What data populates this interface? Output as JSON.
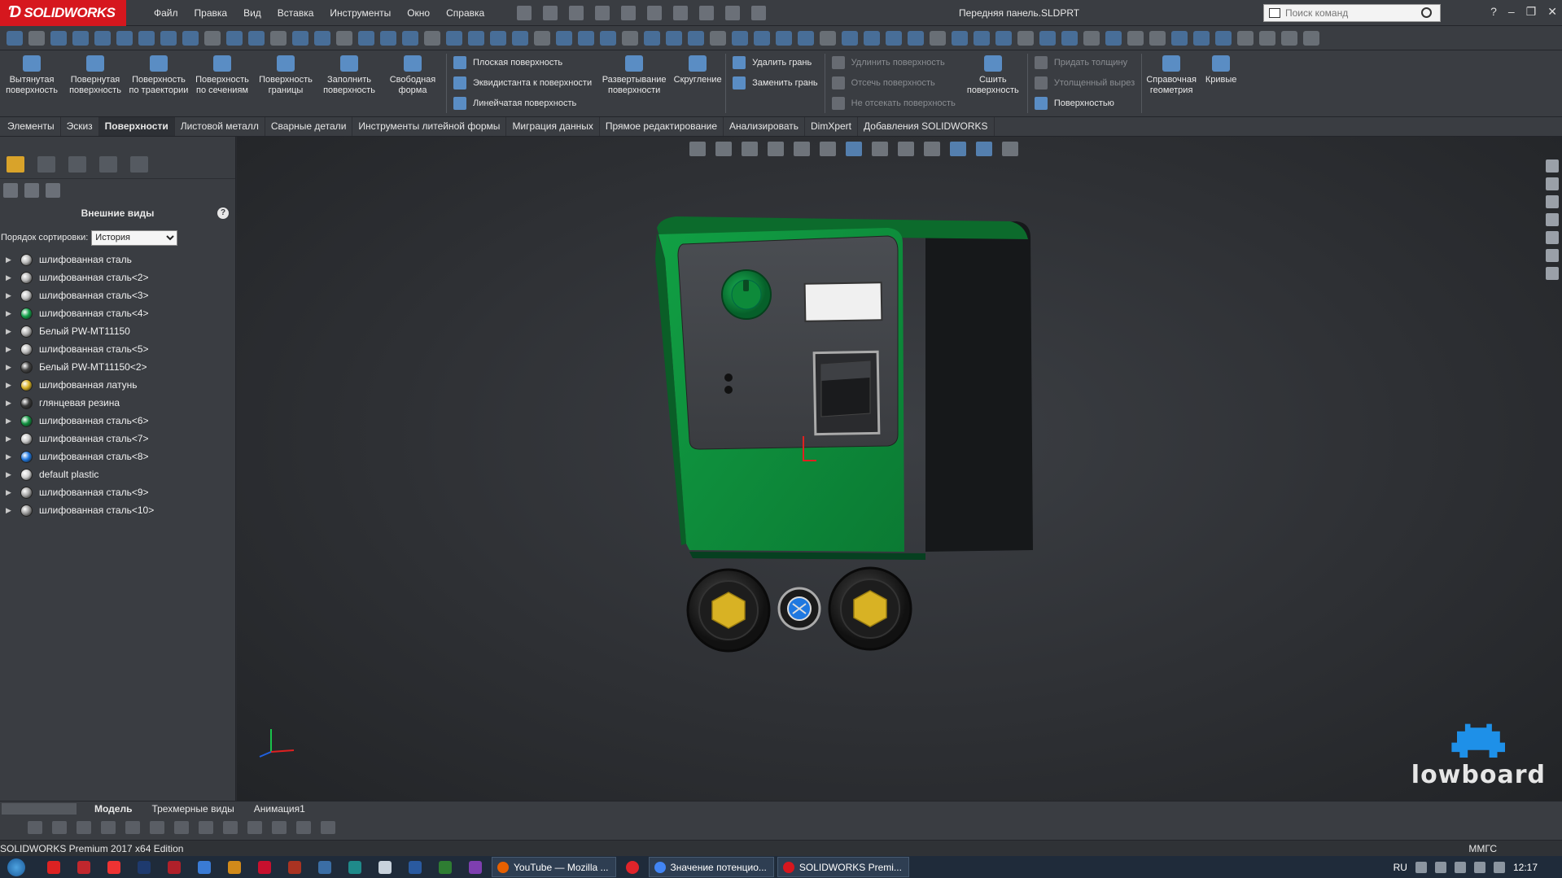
{
  "app": {
    "logo": "SOLIDWORKS",
    "document_title": "Передняя панель.SLDPRT"
  },
  "menu": [
    "Файл",
    "Правка",
    "Вид",
    "Вставка",
    "Инструменты",
    "Окно",
    "Справка"
  ],
  "search": {
    "placeholder": "Поиск команд"
  },
  "ribbon": {
    "big_buttons": [
      "Вытянутая поверхность",
      "Повернутая поверхность",
      "Поверхность по траектории",
      "Поверхность по сечениям",
      "Поверхность границы",
      "Заполнить поверхность",
      "Свободная форма"
    ],
    "col1": [
      "Плоская поверхность",
      "Эквидистанта к поверхности",
      "Линейчатая поверхность"
    ],
    "mid_buttons": [
      "Развертывание поверхности",
      "Скругление"
    ],
    "col2": [
      "Удалить грань",
      "Заменить грань"
    ],
    "col3": [
      "Удлинить поверхность",
      "Отсечь поверхность",
      "Не отсекать поверхность"
    ],
    "knit": "Сшить поверхность",
    "col4": [
      "Придать толщину",
      "Утолщенный вырез",
      "Поверхностью"
    ],
    "end_buttons": [
      "Справочная геометрия",
      "Кривые"
    ]
  },
  "tabs": [
    "Элементы",
    "Эскиз",
    "Поверхности",
    "Листовой металл",
    "Сварные детали",
    "Инструменты литейной формы",
    "Миграция данных",
    "Прямое редактирование",
    "Анализировать",
    "DimXpert",
    "Добавления SOLIDWORKS"
  ],
  "active_tab": "Поверхности",
  "panel": {
    "title": "Внешние виды",
    "help": "?",
    "sort_label": "Порядок сортировки:",
    "sort_value": "История",
    "items": [
      {
        "label": "шлифованная сталь",
        "color": "#b9b9b9"
      },
      {
        "label": "шлифованная сталь<2>",
        "color": "#b5b5b5"
      },
      {
        "label": "шлифованная сталь<3>",
        "color": "#c2c2c2"
      },
      {
        "label": "шлифованная сталь<4>",
        "color": "#12a24a"
      },
      {
        "label": "Белый PW-MT11150",
        "color": "#b0b0b0"
      },
      {
        "label": "шлифованная сталь<5>",
        "color": "#bdbdbd"
      },
      {
        "label": "Белый PW-MT11150<2>",
        "color": "#444444"
      },
      {
        "label": "шлифованная латунь",
        "color": "#d8b224"
      },
      {
        "label": "глянцевая резина",
        "color": "#3a3a3a"
      },
      {
        "label": "шлифованная сталь<6>",
        "color": "#109140"
      },
      {
        "label": "шлифованная сталь<7>",
        "color": "#c8c8c8"
      },
      {
        "label": "шлифованная сталь<8>",
        "color": "#1f78e0"
      },
      {
        "label": "default plastic",
        "color": "#d0d0d0"
      },
      {
        "label": "шлифованная сталь<9>",
        "color": "#a8a8a8"
      },
      {
        "label": "шлифованная сталь<10>",
        "color": "#9c9c9c"
      }
    ]
  },
  "watermark": "lowboard",
  "bottom_tabs": [
    "Модель",
    "Трехмерные виды",
    "Анимация1"
  ],
  "status": {
    "text": "SOLIDWORKS Premium 2017 x64 Edition",
    "units": "ММГС"
  },
  "taskbar": {
    "tasks": [
      {
        "label": "YouTube — Mozilla ...",
        "color": "#e66000"
      },
      {
        "label": "Значение потенцио...",
        "color": "#4285f4"
      },
      {
        "label": "SOLIDWORKS Premi...",
        "color": "#d6171e"
      }
    ],
    "lang": "RU",
    "time": "12:17"
  },
  "colors": {
    "accent": "#d6171e",
    "green_body": "#0d8a3a",
    "brass": "#d8b224"
  }
}
